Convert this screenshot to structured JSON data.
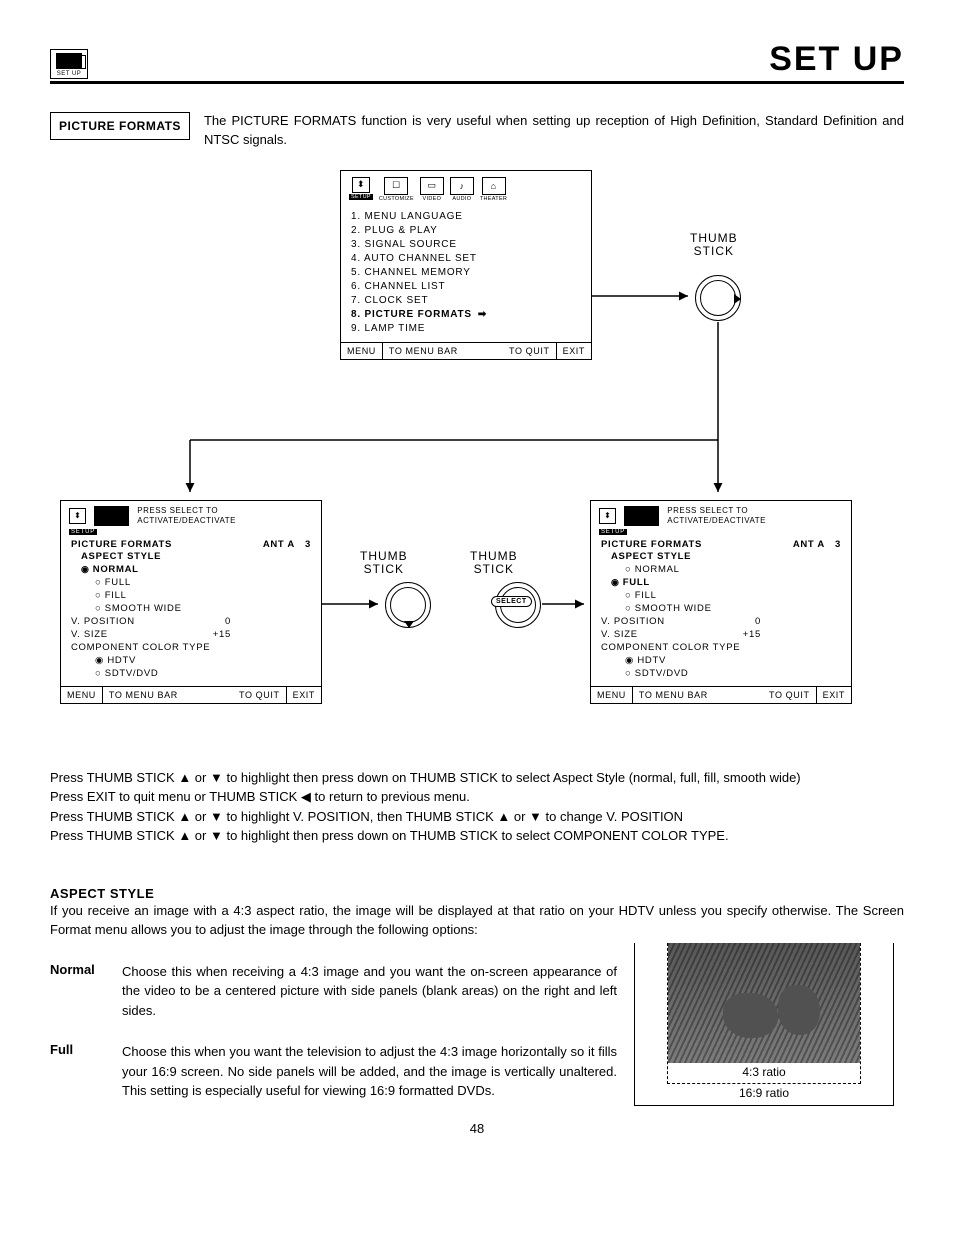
{
  "header": {
    "icon_label": "SET UP",
    "title": "SET UP"
  },
  "section_tag": "PICTURE FORMATS",
  "intro": "The PICTURE FORMATS function is very useful when setting up reception of High Definition, Standard Definition and NTSC signals.",
  "main_menu": {
    "icons": [
      {
        "label": "SETUP",
        "glyph": "⬍"
      },
      {
        "label": "CUSTOMIZE",
        "glyph": "▭"
      },
      {
        "label": "VIDEO",
        "glyph": "▭"
      },
      {
        "label": "AUDIO",
        "glyph": "♪"
      },
      {
        "label": "THEATER",
        "glyph": "⌂"
      }
    ],
    "items": [
      "1. MENU LANGUAGE",
      "2. PLUG & PLAY",
      "3. SIGNAL SOURCE",
      "4. AUTO CHANNEL SET",
      "5. CHANNEL MEMORY",
      "6. CHANNEL LIST",
      "7. CLOCK SET"
    ],
    "selected": "8. PICTURE FORMATS",
    "after": "9. LAMP TIME",
    "foot": {
      "a": "MENU",
      "b": "TO MENU BAR",
      "c": "TO QUIT",
      "d": "EXIT"
    }
  },
  "sub_hint": "PRESS SELECT TO ACTIVATE/DEACTIVATE",
  "sub_label_setup": "SETUP",
  "sub_a": {
    "title": "PICTURE FORMATS",
    "src": "ANT A",
    "num": "3",
    "aspect_label": "ASPECT STYLE",
    "options": [
      {
        "label": "NORMAL",
        "selected": true,
        "on": true
      },
      {
        "label": "FULL",
        "selected": false,
        "on": false
      },
      {
        "label": "FILL",
        "selected": false,
        "on": false
      },
      {
        "label": "SMOOTH WIDE",
        "selected": false,
        "on": false
      }
    ],
    "vpos": {
      "k": "V. POSITION",
      "v": "0"
    },
    "vsize": {
      "k": "V. SIZE",
      "v": "+15"
    },
    "color_label": "COMPONENT COLOR TYPE",
    "color_opts": [
      {
        "label": "HDTV",
        "on": true
      },
      {
        "label": "SDTV/DVD",
        "on": false
      }
    ]
  },
  "sub_b": {
    "title": "PICTURE FORMATS",
    "src": "ANT A",
    "num": "3",
    "aspect_label": "ASPECT STYLE",
    "options": [
      {
        "label": "NORMAL",
        "selected": false,
        "on": false
      },
      {
        "label": "FULL",
        "selected": true,
        "on": true
      },
      {
        "label": "FILL",
        "selected": false,
        "on": false
      },
      {
        "label": "SMOOTH WIDE",
        "selected": false,
        "on": false
      }
    ],
    "vpos": {
      "k": "V. POSITION",
      "v": "0"
    },
    "vsize": {
      "k": "V. SIZE",
      "v": "+15"
    },
    "color_label": "COMPONENT COLOR TYPE",
    "color_opts": [
      {
        "label": "HDTV",
        "on": true
      },
      {
        "label": "SDTV/DVD",
        "on": false
      }
    ]
  },
  "thumb": {
    "line1": "THUMB",
    "line2": "STICK",
    "select": "SELECT"
  },
  "instructions": [
    "Press THUMB STICK ▲ or ▼ to highlight then press down on THUMB STICK to select Aspect Style (normal, full, fill, smooth wide)",
    "Press EXIT to quit menu or THUMB STICK ◀ to return to previous menu.",
    "Press THUMB STICK ▲ or ▼ to highlight V. POSITION, then THUMB STICK ▲ or ▼ to change V. POSITION",
    "Press THUMB STICK ▲ or ▼ to highlight then press down on THUMB STICK to select COMPONENT COLOR TYPE."
  ],
  "aspect": {
    "heading": "ASPECT STYLE",
    "intro": "If you receive an image with a 4:3 aspect ratio, the image will be displayed at that ratio on your HDTV unless you specify otherwise. The Screen Format menu allows you to adjust the image through the following options:",
    "defs": [
      {
        "term": "Normal",
        "desc": "Choose this when receiving a 4:3 image and you want the on-screen appearance of the video to be a centered picture with side panels (blank areas) on the right and left sides."
      },
      {
        "term": "Full",
        "desc": "Choose this when you want the television to adjust the 4:3 image horizontally so it fills your 16:9 screen. No side panels will be added, and the image is vertically unaltered. This setting is especially useful for viewing 16:9 formatted DVDs."
      }
    ]
  },
  "ratio_fig": {
    "inner": "4:3 ratio",
    "outer": "16:9 ratio"
  },
  "page_number": "48"
}
